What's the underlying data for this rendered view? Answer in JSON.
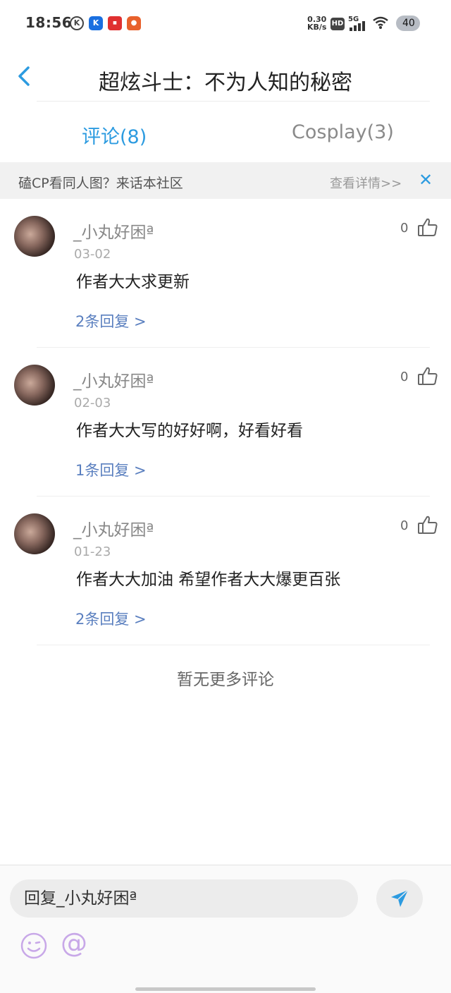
{
  "status_bar": {
    "time": "18:56",
    "net_speed_value": "0.30",
    "net_speed_unit": "KB/s",
    "hd": "HD",
    "network": "5G",
    "battery": "40",
    "app_icons": [
      "k-circle-icon",
      "k-app-icon",
      "red-app-icon",
      "gift-bag-icon"
    ]
  },
  "nav": {
    "title": "超炫斗士：不为人知的秘密"
  },
  "tabs": [
    {
      "label": "评论(8)",
      "active": true
    },
    {
      "label": "Cosplay(3)",
      "active": false
    }
  ],
  "banner": {
    "text": "磕CP看同人图？来话本社区",
    "link": "查看详情>>",
    "close": "✕"
  },
  "comments": [
    {
      "username": "_小丸好困ª",
      "date": "03-02",
      "content": "作者大大求更新",
      "replies": "2条回复 >",
      "likes": "0"
    },
    {
      "username": "_小丸好困ª",
      "date": "02-03",
      "content": "作者大大写的好好啊，好看好看",
      "replies": "1条回复 >",
      "likes": "0"
    },
    {
      "username": "_小丸好困ª",
      "date": "01-23",
      "content": "作者大大加油 希望作者大大爆更百张",
      "replies": "2条回复 >",
      "likes": "0"
    }
  ],
  "no_more": "暂无更多评论",
  "input": {
    "placeholder": "回复_小丸好困ª",
    "at_symbol": "@"
  },
  "colors": {
    "accent": "#2c9be0",
    "reply_link": "#5a7fbf",
    "emoji": "#c8a8e8"
  }
}
